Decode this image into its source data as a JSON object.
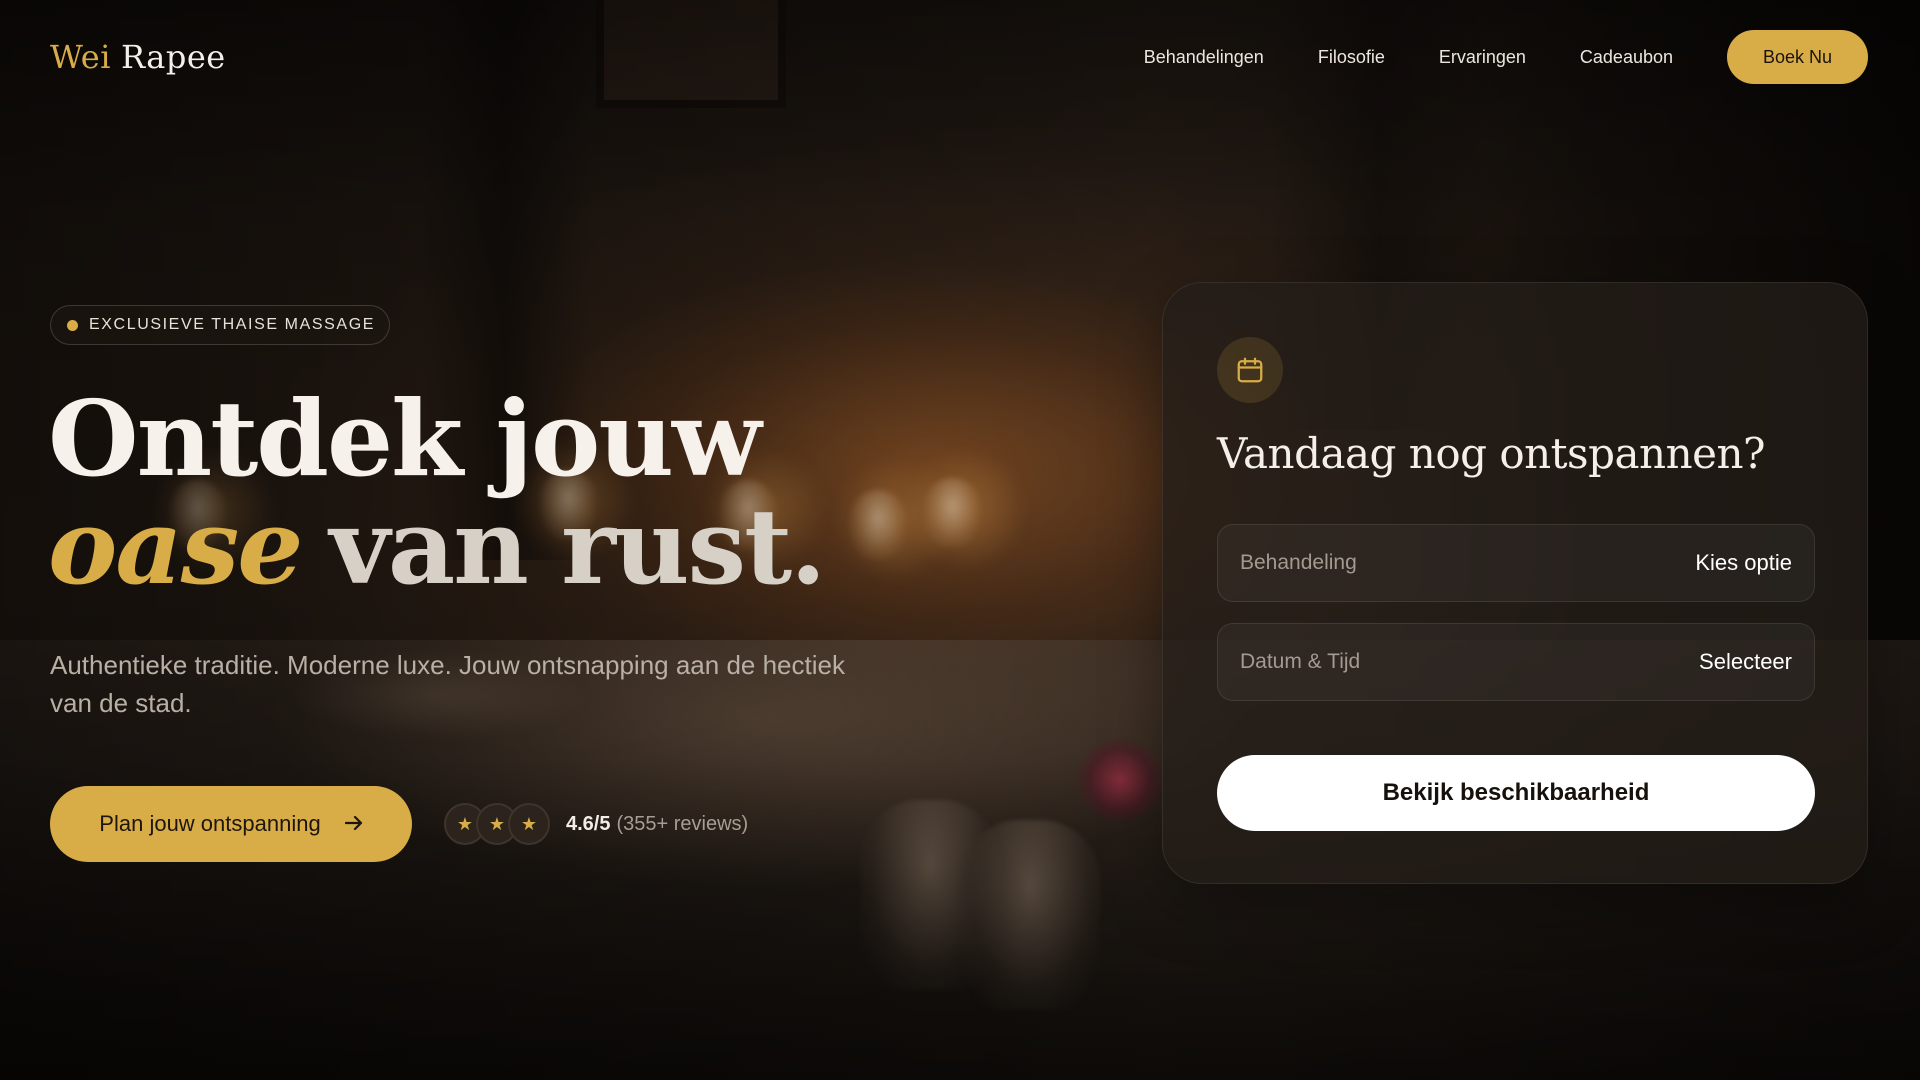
{
  "brand": {
    "part1": "Wei",
    "part2": "Rapee",
    "accent_color": "#d8ad48"
  },
  "nav": {
    "items": [
      "Behandelingen",
      "Filosofie",
      "Ervaringen",
      "Cadeaubon"
    ],
    "book_label": "Boek Nu"
  },
  "hero": {
    "badge": "EXCLUSIEVE THAISE MASSAGE",
    "headline_line1": "Ontdek jouw",
    "headline_italic": "oase",
    "headline_rest": "van rust.",
    "subtext": "Authentieke traditie. Moderne luxe. Jouw ontsnapping aan de hectiek van de stad.",
    "cta_label": "Plan jouw ontspanning",
    "cta_icon": "arrow-right-icon",
    "rating_score": "4.6/5",
    "rating_count": "(355+ reviews)",
    "stars": 3
  },
  "booking": {
    "icon": "calendar-icon",
    "title": "Vandaag nog ontspannen?",
    "treatment_label": "Behandeling",
    "treatment_value": "Kies optie",
    "datetime_label": "Datum & Tijd",
    "datetime_value": "Selecteer",
    "submit_label": "Bekijk beschikbaarheid"
  }
}
